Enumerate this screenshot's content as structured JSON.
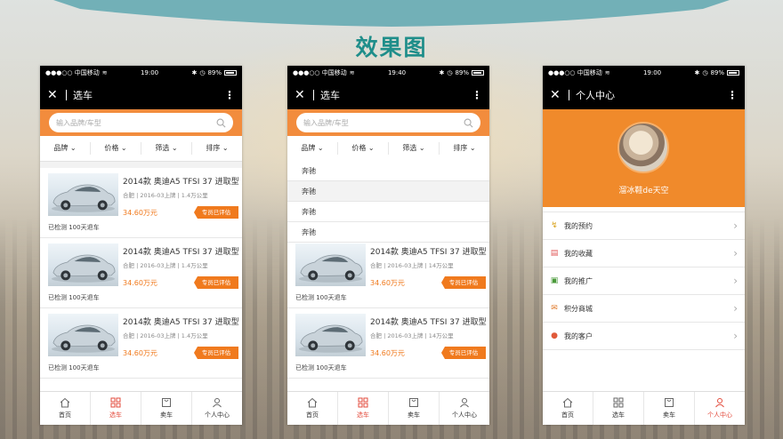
{
  "page": {
    "title": "效果图"
  },
  "colors": {
    "accent": "#f28c3d",
    "title": "#1f8e8a",
    "active_tab": "#e34b3c"
  },
  "status_bar": {
    "carrier": "●●●○○ 中国移动",
    "wifi_icon": "wifi-icon",
    "time": "19:00",
    "battery": "89%"
  },
  "phones": [
    {
      "status_time": "19:00",
      "nav_title": "选车",
      "search_placeholder": "输入品牌/车型",
      "filters": [
        "品牌",
        "价格",
        "筛选",
        "排序"
      ],
      "cars": [
        {
          "title": "2014款 奥迪A5 TFSI 37 进取型",
          "meta": "合肥 | 2016-03上牌 | 1.4万公里",
          "price": "34.60万元",
          "tag": "专员已评估",
          "note": "已检测 100天退车"
        },
        {
          "title": "2014款 奥迪A5 TFSI 37 进取型",
          "meta": "合肥 | 2016-03上牌 | 1.4万公里",
          "price": "34.60万元",
          "tag": "专员已评估",
          "note": "已检测 100天退车"
        },
        {
          "title": "2014款 奥迪A5 TFSI 37 进取型",
          "meta": "合肥 | 2016-03上牌 | 1.4万公里",
          "price": "34.60万元",
          "tag": "专员已评估",
          "note": "已检测 100天退车"
        }
      ]
    },
    {
      "status_time": "19:40",
      "nav_title": "选车",
      "search_placeholder": "输入品牌/车型",
      "filters": [
        "品牌",
        "价格",
        "筛选",
        "排序"
      ],
      "dropdown": [
        "奔驰",
        "奔驰",
        "奔驰",
        "奔驰"
      ],
      "cars": [
        {
          "title": "2014款 奥迪A5 TFSI 37 进取型",
          "meta": "合肥 | 2016-03上牌 | 14万公里",
          "price": "34.60万元",
          "tag": "专员已评估",
          "note": "已检测 100天退车"
        },
        {
          "title": "2014款 奥迪A5 TFSI 37 进取型",
          "meta": "合肥 | 2016-03上牌 | 14万公里",
          "price": "34.60万元",
          "tag": "专员已评估",
          "note": "已检测 100天退车"
        }
      ]
    },
    {
      "status_time": "19:00",
      "nav_title": "个人中心",
      "username": "溜冰鞋de天空",
      "menu": [
        {
          "label": "我的预约",
          "icon": "chart-icon",
          "color": "#d9a21b"
        },
        {
          "label": "我的收藏",
          "icon": "bookmark-icon",
          "color": "#e05a5a"
        },
        {
          "label": "我的推广",
          "icon": "box-icon",
          "color": "#4a9a3a"
        },
        {
          "label": "积分商城",
          "icon": "mail-icon",
          "color": "#e07a2a"
        },
        {
          "label": "我的客户",
          "icon": "user-icon",
          "color": "#e05a3a"
        }
      ]
    }
  ],
  "tabbar": [
    "首页",
    "选车",
    "卖车",
    "个人中心"
  ]
}
